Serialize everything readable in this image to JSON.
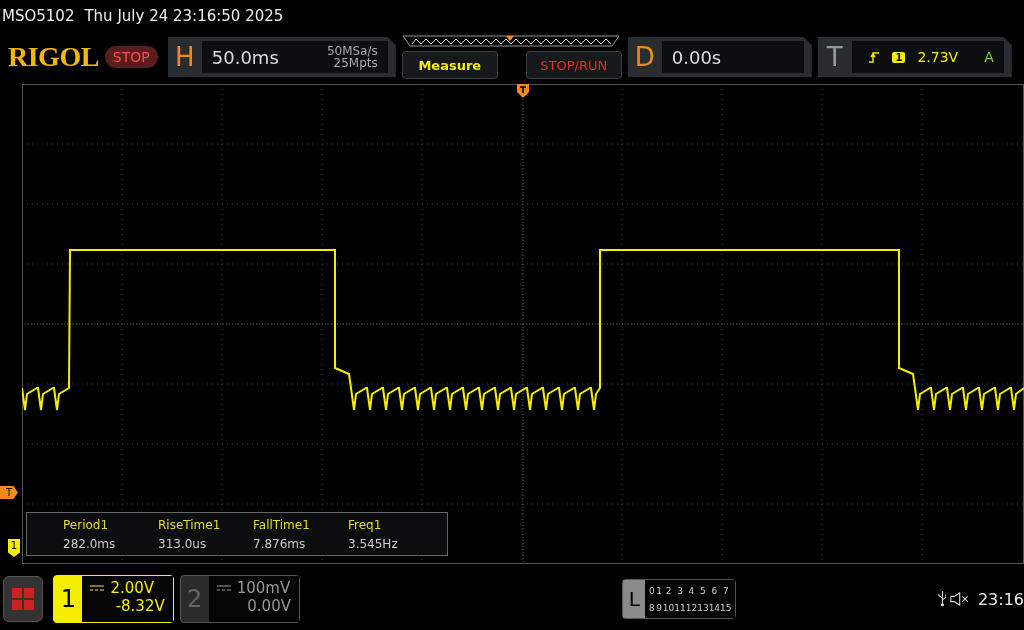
{
  "header": {
    "model": "MSO5102",
    "datetime": "Thu July 24 23:16:50 2025"
  },
  "toolbar": {
    "logo": "RIGOL",
    "run_state": "STOP",
    "horizontal": {
      "label": "H",
      "timebase": "50.0ms",
      "sample_rate": "50MSa/s",
      "memory_depth": "25Mpts"
    },
    "buttons": [
      {
        "label": "Measure",
        "kind": "measure"
      },
      {
        "label": "STOP/RUN",
        "kind": "run"
      }
    ],
    "delay": {
      "label": "D",
      "value": "0.00s"
    },
    "trigger": {
      "label": "T",
      "source": "1",
      "level": "2.73V",
      "mode": "A"
    }
  },
  "markers": {
    "trigger_level": "T",
    "channel_1": "1"
  },
  "measurements": [
    {
      "name": "Period1",
      "value": "282.0ms"
    },
    {
      "name": "RiseTime1",
      "value": "313.0us"
    },
    {
      "name": "FallTime1",
      "value": "7.876ms"
    },
    {
      "name": "Freq1",
      "value": "3.545Hz"
    }
  ],
  "channels": [
    {
      "number": "1",
      "scale": "2.00V",
      "offset": "-8.32V",
      "active": true
    },
    {
      "number": "2",
      "scale": "100mV",
      "offset": "0.00V",
      "active": false
    }
  ],
  "logic": {
    "label": "L",
    "bits": [
      "0",
      "1",
      "2",
      "3",
      "4",
      "5",
      "6",
      "7",
      "8",
      "9",
      "10",
      "11",
      "12",
      "13",
      "14",
      "15"
    ]
  },
  "status": {
    "time": "23:16"
  }
}
